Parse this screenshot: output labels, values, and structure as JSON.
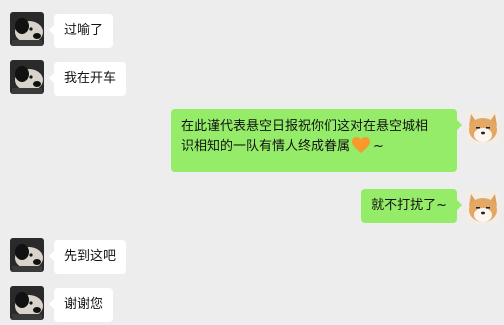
{
  "messages": [
    {
      "side": "left",
      "text": "过喻了"
    },
    {
      "side": "left",
      "text": "我在开车"
    },
    {
      "side": "right",
      "line1": "在此谨代表悬空日报祝你们这对在悬空城相",
      "line2": "识相知的一队有情人终成眷属",
      "suffix": "~",
      "emoji": "orange-heart-icon"
    },
    {
      "side": "right",
      "text": "就不打扰了~"
    },
    {
      "side": "left",
      "text": "先到这吧"
    },
    {
      "side": "left",
      "text": "谢谢您"
    }
  ],
  "colors": {
    "background": "#ededed",
    "incoming_bubble": "#ffffff",
    "outgoing_bubble": "#95ec69",
    "heart": "#f79a2b"
  },
  "avatars": {
    "left": "dog-avatar-dark",
    "right": "shiba-avatar"
  }
}
